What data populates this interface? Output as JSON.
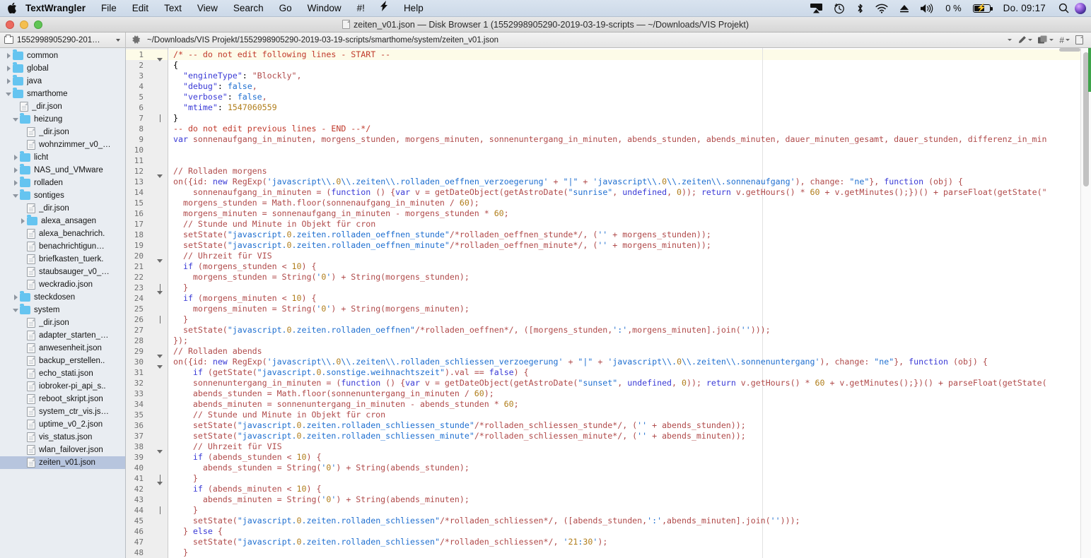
{
  "menubar": {
    "apple_icon": "apple-logo-icon",
    "app_name": "TextWrangler",
    "items": [
      "File",
      "Edit",
      "Text",
      "View",
      "Search",
      "Go",
      "Window",
      "#!"
    ],
    "script_menu_icon": "lightning-bolt-icon",
    "help_label": "Help",
    "status": {
      "airplay_icon": "airplay-icon",
      "timemachine_icon": "time-machine-icon",
      "bluetooth_icon": "bluetooth-icon",
      "wifi_icon": "wifi-icon",
      "eject_icon": "eject-icon",
      "volume_icon": "volume-icon",
      "battery_percent": "0 %",
      "battery_icon": "battery-charging-icon",
      "clock": "Do. 09:17",
      "search_icon": "spotlight-search-icon",
      "siri_icon": "siri-icon"
    }
  },
  "window": {
    "title": "zeiten_v01.json — Disk Browser 1 (1552998905290-2019-03-19-scripts — ~/Downloads/VIS Projekt)",
    "title_icon": "document-icon",
    "traffic": {
      "close": "close-button",
      "minimize": "minimize-button",
      "zoom": "zoom-button"
    }
  },
  "toolbar": {
    "browser_popup_label": "1552998905290-201…",
    "browser_popup_icon": "folder-icon",
    "gear_icon": "gear-icon",
    "file_path": "~/Downloads/VIS Projekt/1552998905290-2019-03-19-scripts/smarthome/system/zeiten_v01.json",
    "right_icons": [
      "function-popup-icon",
      "pencil-popup-icon",
      "documents-popup-icon",
      "hash-popup-icon",
      "new-document-icon"
    ]
  },
  "sidebar": {
    "items": [
      {
        "label": "common",
        "type": "folder",
        "depth": 1,
        "disc": "closed",
        "selected": false
      },
      {
        "label": "global",
        "type": "folder",
        "depth": 1,
        "disc": "closed",
        "selected": false
      },
      {
        "label": "java",
        "type": "folder",
        "depth": 1,
        "disc": "closed",
        "selected": false
      },
      {
        "label": "smarthome",
        "type": "folder",
        "depth": 1,
        "disc": "open",
        "selected": false
      },
      {
        "label": "_dir.json",
        "type": "file",
        "depth": 2,
        "disc": "none",
        "selected": false
      },
      {
        "label": "heizung",
        "type": "folder",
        "depth": 2,
        "disc": "open",
        "selected": false
      },
      {
        "label": "_dir.json",
        "type": "file",
        "depth": 3,
        "disc": "none",
        "selected": false
      },
      {
        "label": "wohnzimmer_v0_…",
        "type": "file",
        "depth": 3,
        "disc": "none",
        "selected": false
      },
      {
        "label": "licht",
        "type": "folder",
        "depth": 2,
        "disc": "closed",
        "selected": false
      },
      {
        "label": "NAS_und_VMware",
        "type": "folder",
        "depth": 2,
        "disc": "closed",
        "selected": false
      },
      {
        "label": "rolladen",
        "type": "folder",
        "depth": 2,
        "disc": "closed",
        "selected": false
      },
      {
        "label": "sontiges",
        "type": "folder",
        "depth": 2,
        "disc": "open",
        "selected": false
      },
      {
        "label": "_dir.json",
        "type": "file",
        "depth": 3,
        "disc": "none",
        "selected": false
      },
      {
        "label": "alexa_ansagen",
        "type": "folder",
        "depth": 3,
        "disc": "closed",
        "selected": false
      },
      {
        "label": "alexa_benachrich.",
        "type": "file",
        "depth": 3,
        "disc": "none",
        "selected": false
      },
      {
        "label": "benachrichtigun…",
        "type": "file",
        "depth": 3,
        "disc": "none",
        "selected": false
      },
      {
        "label": "briefkasten_tuerk.",
        "type": "file",
        "depth": 3,
        "disc": "none",
        "selected": false
      },
      {
        "label": "staubsauger_v0_…",
        "type": "file",
        "depth": 3,
        "disc": "none",
        "selected": false
      },
      {
        "label": "weckradio.json",
        "type": "file",
        "depth": 3,
        "disc": "none",
        "selected": false
      },
      {
        "label": "steckdosen",
        "type": "folder",
        "depth": 2,
        "disc": "closed",
        "selected": false
      },
      {
        "label": "system",
        "type": "folder",
        "depth": 2,
        "disc": "open",
        "selected": false
      },
      {
        "label": "_dir.json",
        "type": "file",
        "depth": 3,
        "disc": "none",
        "selected": false
      },
      {
        "label": "adapter_starten_…",
        "type": "file",
        "depth": 3,
        "disc": "none",
        "selected": false
      },
      {
        "label": "anwesenheit.json",
        "type": "file",
        "depth": 3,
        "disc": "none",
        "selected": false
      },
      {
        "label": "backup_erstellen..",
        "type": "file",
        "depth": 3,
        "disc": "none",
        "selected": false
      },
      {
        "label": "echo_stati.json",
        "type": "file",
        "depth": 3,
        "disc": "none",
        "selected": false
      },
      {
        "label": "iobroker-pi_api_s..",
        "type": "file",
        "depth": 3,
        "disc": "none",
        "selected": false
      },
      {
        "label": "reboot_skript.json",
        "type": "file",
        "depth": 3,
        "disc": "none",
        "selected": false
      },
      {
        "label": "system_ctr_vis.js…",
        "type": "file",
        "depth": 3,
        "disc": "none",
        "selected": false
      },
      {
        "label": "uptime_v0_2.json",
        "type": "file",
        "depth": 3,
        "disc": "none",
        "selected": false
      },
      {
        "label": "vis_status.json",
        "type": "file",
        "depth": 3,
        "disc": "none",
        "selected": false
      },
      {
        "label": "wlan_failover.json",
        "type": "file",
        "depth": 3,
        "disc": "none",
        "selected": false
      },
      {
        "label": "zeiten_v01.json",
        "type": "file",
        "depth": 3,
        "disc": "none",
        "selected": true
      }
    ]
  },
  "editor": {
    "first_line_number": 1,
    "highlighted_line": 1,
    "lines": [
      {
        "n": 1,
        "fold": "none",
        "hl": true,
        "text": "/* -- do not edit following lines - START --"
      },
      {
        "n": 2,
        "fold": "tri",
        "hl": false,
        "text": "{"
      },
      {
        "n": 3,
        "fold": "none",
        "hl": false,
        "text": "  \"engineType\": \"Blockly\","
      },
      {
        "n": 4,
        "fold": "none",
        "hl": false,
        "text": "  \"debug\": false,"
      },
      {
        "n": 5,
        "fold": "none",
        "hl": false,
        "text": "  \"verbose\": false,"
      },
      {
        "n": 6,
        "fold": "none",
        "hl": false,
        "text": "  \"mtime\": 1547060559"
      },
      {
        "n": 7,
        "fold": "elbow",
        "hl": false,
        "text": "}"
      },
      {
        "n": 8,
        "fold": "none",
        "hl": false,
        "text": "-- do not edit previous lines - END --*/"
      },
      {
        "n": 9,
        "fold": "none",
        "hl": false,
        "text": "var sonnenaufgang_in_minuten, morgens_stunden, morgens_minuten, sonnenuntergang_in_minuten, abends_stunden, abends_minuten, dauer_minuten_gesamt, dauer_stunden, differenz_in_min"
      },
      {
        "n": 10,
        "fold": "none",
        "hl": false,
        "text": ""
      },
      {
        "n": 11,
        "fold": "none",
        "hl": false,
        "text": ""
      },
      {
        "n": 12,
        "fold": "none",
        "hl": false,
        "text": "// Rolladen morgens"
      },
      {
        "n": 13,
        "fold": "tri",
        "hl": false,
        "text": "on({id: new RegExp('javascript\\\\.0\\\\.zeiten\\\\.rolladen_oeffnen_verzoegerung' + \"|\" + 'javascript\\\\.0\\\\.zeiten\\\\.sonnenaufgang'), change: \"ne\"}, function (obj) {"
      },
      {
        "n": 14,
        "fold": "none",
        "hl": false,
        "text": "    sonnenaufgang_in_minuten = (function () {var v = getDateObject(getAstroDate(\"sunrise\", undefined, 0)); return v.getHours() * 60 + v.getMinutes();})() + parseFloat(getState(\""
      },
      {
        "n": 15,
        "fold": "none",
        "hl": false,
        "text": "  morgens_stunden = Math.floor(sonnenaufgang_in_minuten / 60);"
      },
      {
        "n": 16,
        "fold": "none",
        "hl": false,
        "text": "  morgens_minuten = sonnenaufgang_in_minuten - morgens_stunden * 60;"
      },
      {
        "n": 17,
        "fold": "none",
        "hl": false,
        "text": "  // Stunde und Minute in Objekt für cron"
      },
      {
        "n": 18,
        "fold": "none",
        "hl": false,
        "text": "  setState(\"javascript.0.zeiten.rolladen_oeffnen_stunde\"/*rolladen_oeffnen_stunde*/, ('' + morgens_stunden));"
      },
      {
        "n": 19,
        "fold": "none",
        "hl": false,
        "text": "  setState(\"javascript.0.zeiten.rolladen_oeffnen_minute\"/*rolladen_oeffnen_minute*/, ('' + morgens_minuten));"
      },
      {
        "n": 20,
        "fold": "none",
        "hl": false,
        "text": "  // Uhrzeit für VIS"
      },
      {
        "n": 21,
        "fold": "tri",
        "hl": false,
        "text": "  if (morgens_stunden < 10) {"
      },
      {
        "n": 22,
        "fold": "none",
        "hl": false,
        "text": "    morgens_stunden = String('0') + String(morgens_stunden);"
      },
      {
        "n": 23,
        "fold": "elbow",
        "hl": false,
        "text": "  }"
      },
      {
        "n": 24,
        "fold": "tri",
        "hl": false,
        "text": "  if (morgens_minuten < 10) {"
      },
      {
        "n": 25,
        "fold": "none",
        "hl": false,
        "text": "    morgens_minuten = String('0') + String(morgens_minuten);"
      },
      {
        "n": 26,
        "fold": "elbow",
        "hl": false,
        "text": "  }"
      },
      {
        "n": 27,
        "fold": "none",
        "hl": false,
        "text": "  setState(\"javascript.0.zeiten.rolladen_oeffnen\"/*rolladen_oeffnen*/, ([morgens_stunden,':',morgens_minuten].join('')));"
      },
      {
        "n": 28,
        "fold": "none",
        "hl": false,
        "text": "});"
      },
      {
        "n": 29,
        "fold": "none",
        "hl": false,
        "text": "// Rolladen abends"
      },
      {
        "n": 30,
        "fold": "tri",
        "hl": false,
        "text": "on({id: new RegExp('javascript\\\\.0\\\\.zeiten\\\\.rolladen_schliessen_verzoegerung' + \"|\" + 'javascript\\\\.0\\\\.zeiten\\\\.sonnenuntergang'), change: \"ne\"}, function (obj) {"
      },
      {
        "n": 31,
        "fold": "tri",
        "hl": false,
        "text": "    if (getState(\"javascript.0.sonstige.weihnachtszeit\").val == false) {"
      },
      {
        "n": 32,
        "fold": "none",
        "hl": false,
        "text": "    sonnenuntergang_in_minuten = (function () {var v = getDateObject(getAstroDate(\"sunset\", undefined, 0)); return v.getHours() * 60 + v.getMinutes();})() + parseFloat(getState("
      },
      {
        "n": 33,
        "fold": "none",
        "hl": false,
        "text": "    abends_stunden = Math.floor(sonnenuntergang_in_minuten / 60);"
      },
      {
        "n": 34,
        "fold": "none",
        "hl": false,
        "text": "    abends_minuten = sonnenuntergang_in_minuten - abends_stunden * 60;"
      },
      {
        "n": 35,
        "fold": "none",
        "hl": false,
        "text": "    // Stunde und Minute in Objekt für cron"
      },
      {
        "n": 36,
        "fold": "none",
        "hl": false,
        "text": "    setState(\"javascript.0.zeiten.rolladen_schliessen_stunde\"/*rolladen_schliessen_stunde*/, ('' + abends_stunden));"
      },
      {
        "n": 37,
        "fold": "none",
        "hl": false,
        "text": "    setState(\"javascript.0.zeiten.rolladen_schliessen_minute\"/*rolladen_schliessen_minute*/, ('' + abends_minuten));"
      },
      {
        "n": 38,
        "fold": "none",
        "hl": false,
        "text": "    // Uhrzeit für VIS"
      },
      {
        "n": 39,
        "fold": "tri",
        "hl": false,
        "text": "    if (abends_stunden < 10) {"
      },
      {
        "n": 40,
        "fold": "none",
        "hl": false,
        "text": "      abends_stunden = String('0') + String(abends_stunden);"
      },
      {
        "n": 41,
        "fold": "elbow",
        "hl": false,
        "text": "    }"
      },
      {
        "n": 42,
        "fold": "tri",
        "hl": false,
        "text": "    if (abends_minuten < 10) {"
      },
      {
        "n": 43,
        "fold": "none",
        "hl": false,
        "text": "      abends_minuten = String('0') + String(abends_minuten);"
      },
      {
        "n": 44,
        "fold": "elbow",
        "hl": false,
        "text": "    }"
      },
      {
        "n": 45,
        "fold": "none",
        "hl": false,
        "text": "    setState(\"javascript.0.zeiten.rolladen_schliessen\"/*rolladen_schliessen*/, ([abends_stunden,':',abends_minuten].join('')));"
      },
      {
        "n": 46,
        "fold": "none",
        "hl": false,
        "text": "  } else {"
      },
      {
        "n": 47,
        "fold": "none",
        "hl": false,
        "text": "    setState(\"javascript.0.zeiten.rolladen_schliessen\"/*rolladen_schliessen*/, '21:30');"
      },
      {
        "n": 48,
        "fold": "none",
        "hl": false,
        "text": "  }"
      }
    ]
  },
  "colors": {
    "selection": "#b7c5de",
    "folder": "#65c4f0",
    "code_default": "#b04a4a",
    "code_string": "#1f6fd0",
    "code_key": "#3a3ad6",
    "code_number": "#b07d1a",
    "highlight_line": "#fdfbe8",
    "green_indicator": "#3ea34a"
  }
}
